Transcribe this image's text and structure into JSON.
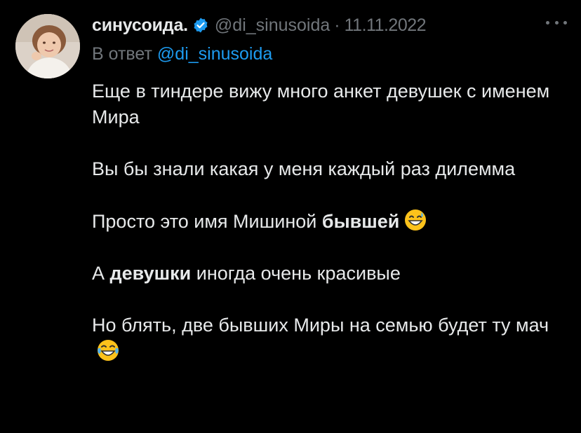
{
  "tweet": {
    "display_name": "синусоида.",
    "handle": "@di_sinusoida",
    "separator": "·",
    "date": "11.11.2022",
    "reply_prefix": "В ответ",
    "reply_handle": "@di_sinusoida",
    "verified_icon": "verified-badge-icon",
    "more_icon": "more-horizontal-icon",
    "colors": {
      "background": "#000000",
      "text": "#e7e9ea",
      "muted": "#71767b",
      "link": "#1d9bf0",
      "verified": "#1d9bf0"
    },
    "paragraphs": {
      "p1": "Еще в тиндере вижу много анкет девушек с именем Мира",
      "p2": "Вы бы знали какая у меня каждый раз дилемма",
      "p3_before": "Просто это имя Мишиной ",
      "p3_bold": "бывшей",
      "p4_before": "А ",
      "p4_bold": "девушки",
      "p4_after": " иногда очень красивые",
      "p5": "Но блять, две бывших Миры на семью будет ту мач"
    },
    "emojis": {
      "p3": "grinning-face-with-sweat",
      "p5": "face-with-tears-of-joy"
    }
  }
}
